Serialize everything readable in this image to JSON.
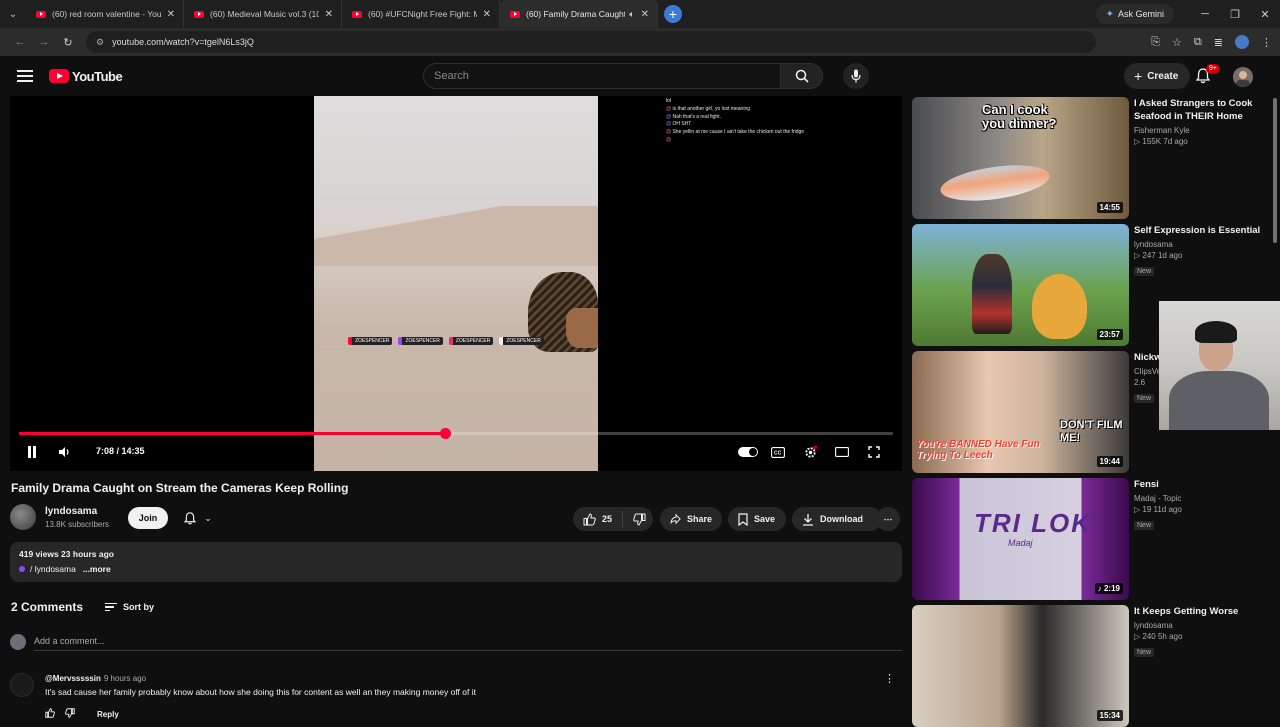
{
  "browser": {
    "tabs": [
      {
        "label": "(60) red room valentine - YouTu"
      },
      {
        "label": "(60) Medieval Music vol.3 (100"
      },
      {
        "label": "(60) #UFCNight Free Fight: Mc"
      },
      {
        "label": "(60) Family Drama Caught o",
        "active": true
      }
    ],
    "gemini_label": "Ask Gemini",
    "url": "youtube.com/watch?v=tgelN6Ls3jQ"
  },
  "header": {
    "logo_text": "YouTube",
    "search_placeholder": "Search",
    "create_label": "Create",
    "notif_badge": "9+"
  },
  "player": {
    "chat": [
      {
        "user": "",
        "msg": "lol"
      },
      {
        "user": "@",
        "msg": "is that another girl, yo lost meaning"
      },
      {
        "user": "@",
        "msg": "Nah that's a real fight."
      },
      {
        "user": "@",
        "msg": "OH SHT"
      },
      {
        "user": "@",
        "msg": "She yellin at me cause I ain't take the chicken out the fridge"
      },
      {
        "user": "@",
        "msg": ""
      }
    ],
    "socials": [
      "ZOESPENCER",
      "ZOESPENCER",
      "ZOESPENCER",
      "ZOESPENCER"
    ],
    "current_time": "7:08",
    "duration": "14:35",
    "progress": 0.4875
  },
  "video": {
    "title": "Family Drama Caught on Stream the Cameras Keep Rolling",
    "channel": "lyndosama",
    "subscribers": "13.8K subscribers",
    "join_label": "Join",
    "likes": "25",
    "share_label": "Share",
    "save_label": "Save",
    "download_label": "Download",
    "views_date": "419 views  23 hours ago",
    "desc_tag": "/ lyndosama",
    "more_label": "...more"
  },
  "comments": {
    "count_label": "2 Comments",
    "sort_label": "Sort by",
    "add_placeholder": "Add a comment...",
    "items": [
      {
        "author": "@Mervsssssin",
        "ago": "9 hours ago",
        "text": "It's sad cause her family probably know about how she doing this for content as well an they making money off of it",
        "reply_label": "Reply"
      }
    ]
  },
  "recommendations": [
    {
      "title": "I Asked Strangers to Cook Seafood in THEIR Home",
      "channel": "Fisherman Kyle",
      "stats": "155K  7d ago",
      "duration": "14:55",
      "badge": "",
      "thumb_text": "Can I cook you dinner?"
    },
    {
      "title": "Self Expression is Essential",
      "channel": "lyndosama",
      "stats": "247  1d ago",
      "duration": "23:57",
      "badge": "New",
      "thumb_text": ""
    },
    {
      "title": "Nickw WSM Kebat",
      "channel": "ClipsVe",
      "stats": "2.6",
      "duration": "19:44",
      "badge": "New",
      "thumb_text": "You're BANNED Have Fun Trying To Leech",
      "thumb_text2": "DON'T FILM ME!"
    },
    {
      "title": "Fensi",
      "channel": "Madaj - Topic",
      "stats": "19  11d ago",
      "duration": "2:19",
      "badge": "New",
      "thumb_text": "TRI LOK",
      "thumb_sub": "Madaj"
    },
    {
      "title": "It Keeps Getting Worse",
      "channel": "lyndosama",
      "stats": "240  5h ago",
      "duration": "15:34",
      "badge": "New",
      "thumb_text": ""
    }
  ]
}
